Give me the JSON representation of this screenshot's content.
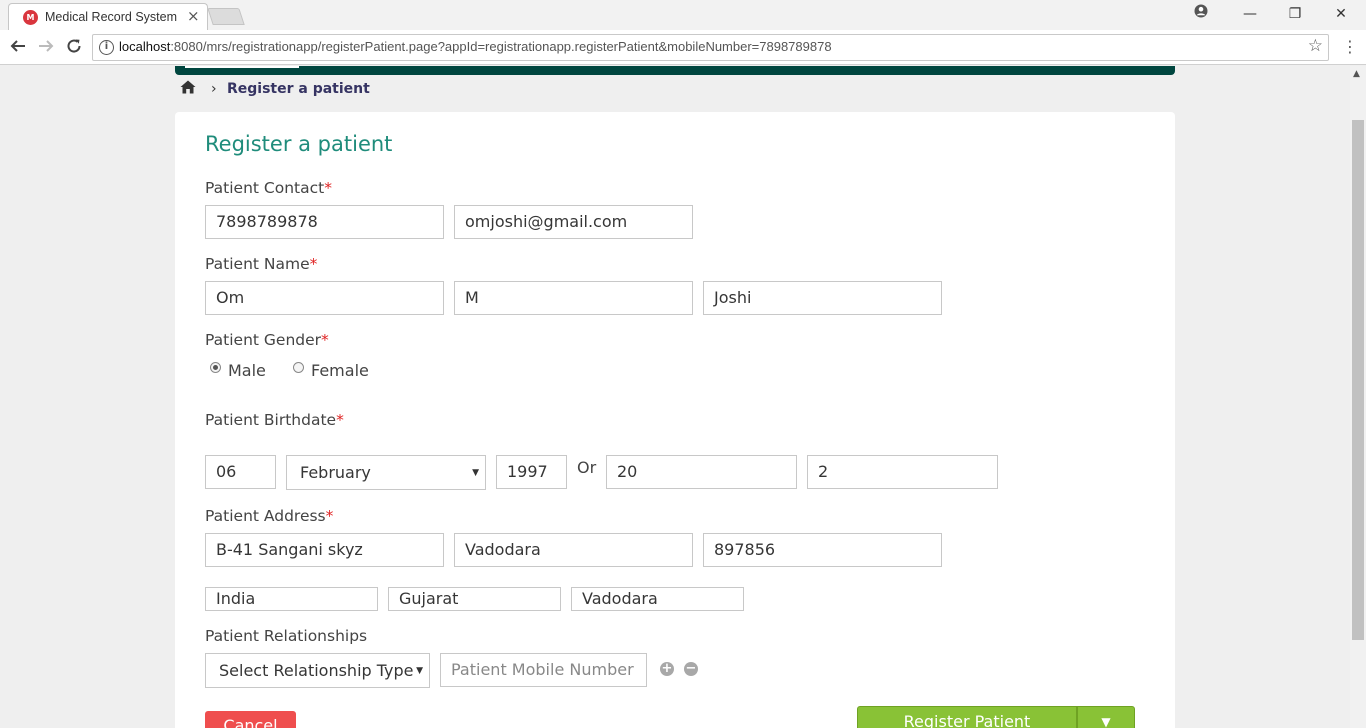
{
  "browser": {
    "tab_title": "Medical Record System",
    "favicon_text": "M",
    "tab_close": "×",
    "url_host": "localhost",
    "url_rest": ":8080/mrs/registrationapp/registerPatient.page?appId=registrationapp.registerPatient&mobileNumber=7898789878",
    "account_icon": "account-circle-icon",
    "minimize": "—",
    "restore": "❐",
    "close": "✕"
  },
  "breadcrumb": {
    "home_icon": "⌂",
    "separator": "›",
    "current": "Register a patient"
  },
  "form": {
    "title": "Register a patient",
    "required_mark": "*",
    "contact": {
      "label": "Patient Contact",
      "mobile": "7898789878",
      "email": "omjoshi@gmail.com"
    },
    "name": {
      "label": "Patient Name",
      "first": "Om",
      "middle": "M",
      "last": "Joshi"
    },
    "gender": {
      "label": "Patient Gender",
      "options": [
        "Male",
        "Female"
      ],
      "selected": "Male"
    },
    "birthdate": {
      "label": "Patient Birthdate",
      "day": "06",
      "month": "February",
      "year": "1997",
      "or_label": "Or",
      "age_years": "20",
      "age_months": "2"
    },
    "address": {
      "label": "Patient Address",
      "line1": "B-41 Sangani skyz",
      "city": "Vadodara",
      "pincode": "897856",
      "country": "India",
      "state": "Gujarat",
      "district": "Vadodara"
    },
    "relationships": {
      "label": "Patient Relationships",
      "type_select": "Select Relationship Type",
      "mobile_placeholder": "Patient Mobile Number",
      "add_icon": "+",
      "remove_icon": "−"
    },
    "buttons": {
      "cancel": "Cancel",
      "register": "Register Patient",
      "dropdown_caret": "▼"
    }
  }
}
